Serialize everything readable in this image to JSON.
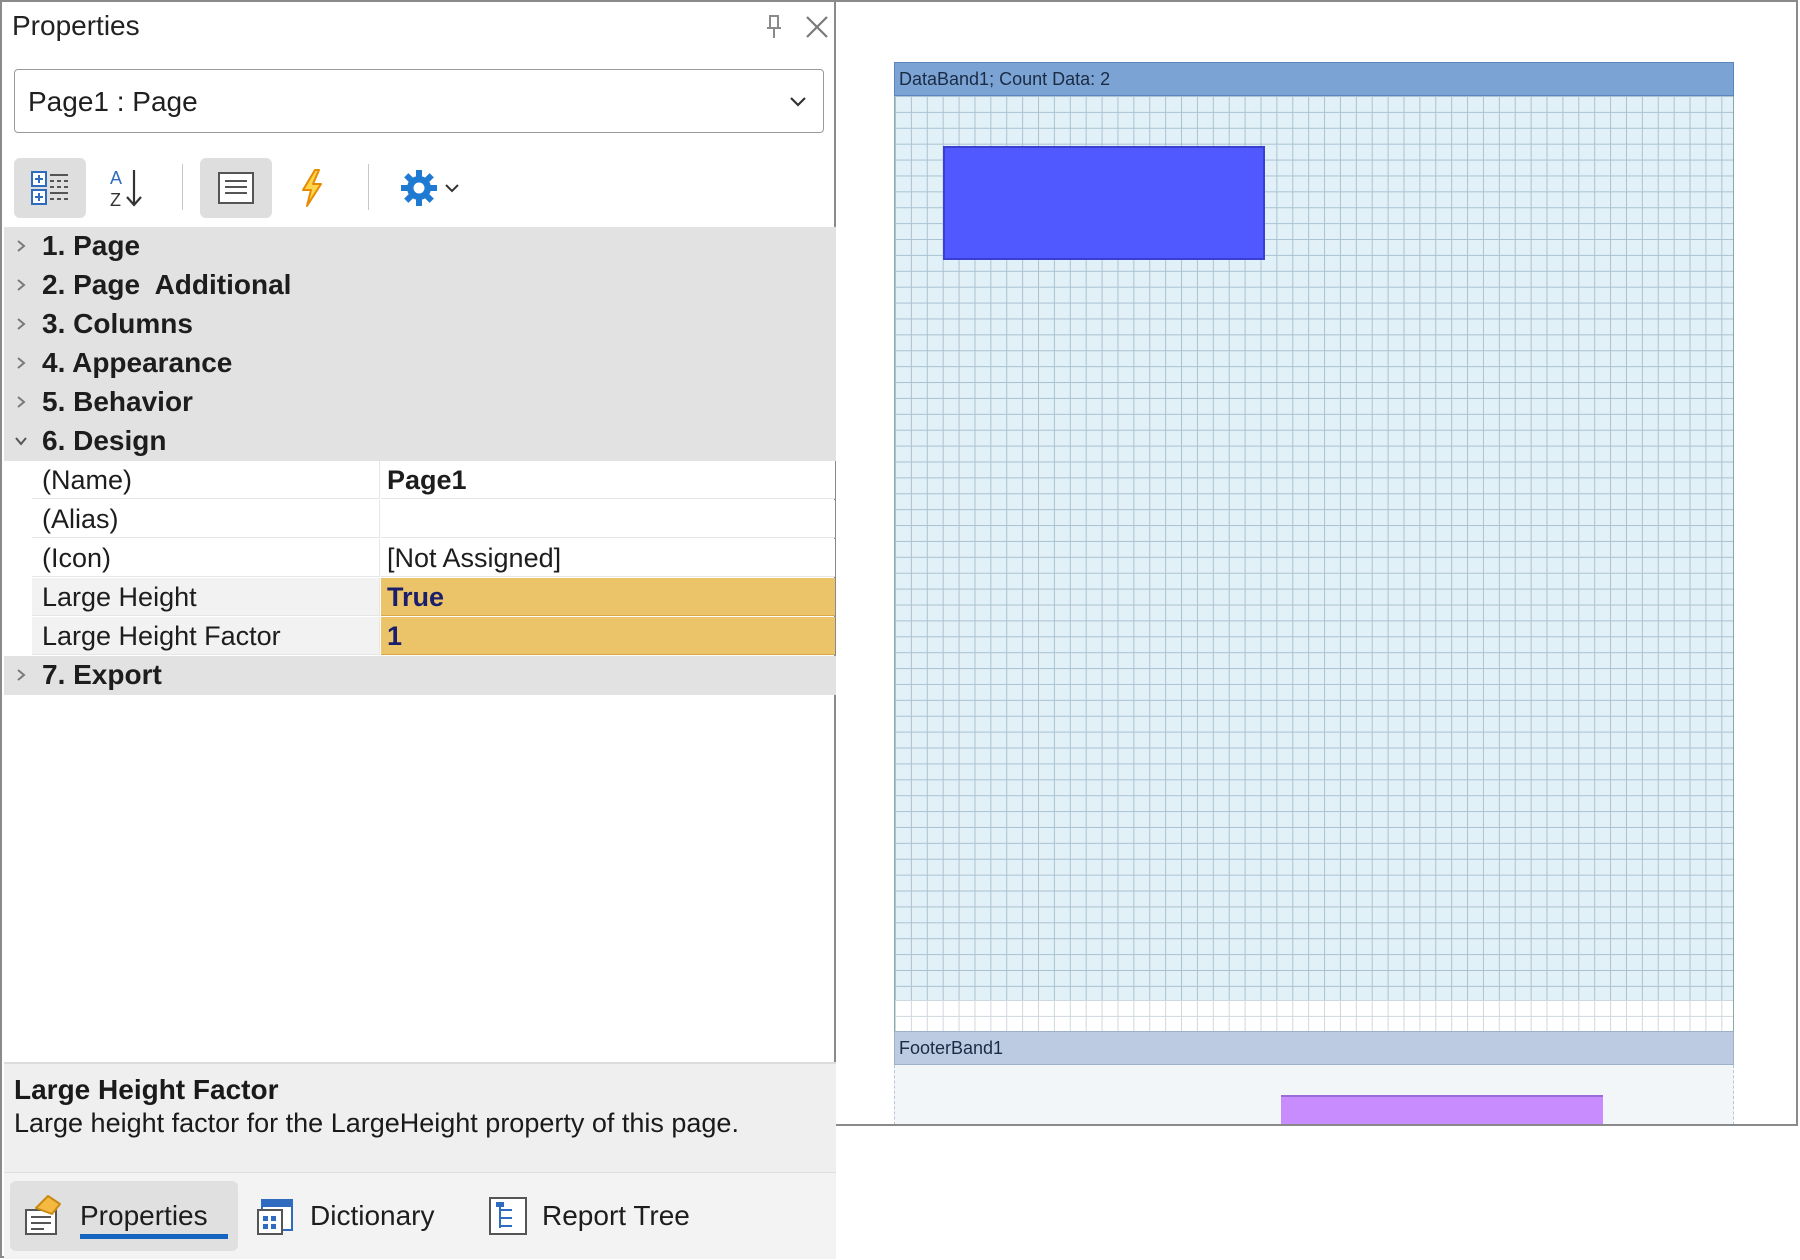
{
  "panel": {
    "title": "Properties",
    "pin_icon": "pin-icon",
    "close_icon": "close-icon",
    "object_selector": {
      "value": "Page1 : Page"
    },
    "toolbar": {
      "buttons": [
        {
          "name": "categorized-view",
          "icon": "categorized-icon",
          "active": true
        },
        {
          "name": "alphabetical-sort",
          "icon": "sort-az-icon",
          "active": false
        },
        {
          "name": "properties-view",
          "icon": "property-list-icon",
          "active": true
        },
        {
          "name": "events-view",
          "icon": "lightning-icon",
          "active": false
        },
        {
          "name": "settings",
          "icon": "gear-icon",
          "active": false
        }
      ]
    },
    "categories": [
      {
        "label": "1. Page",
        "expanded": false
      },
      {
        "label": "2. Page  Additional",
        "expanded": false
      },
      {
        "label": "3. Columns",
        "expanded": false
      },
      {
        "label": "4. Appearance",
        "expanded": false
      },
      {
        "label": "5. Behavior",
        "expanded": false
      },
      {
        "label": "6. Design",
        "expanded": true
      },
      {
        "label": "7. Export",
        "expanded": false
      }
    ],
    "design_properties": [
      {
        "name": "(Name)",
        "value": "Page1"
      },
      {
        "name": "(Alias)",
        "value": ""
      },
      {
        "name": "(Icon)",
        "value": "[Not Assigned]"
      },
      {
        "name": "Large Height",
        "value": "True"
      },
      {
        "name": "Large Height Factor",
        "value": "1"
      }
    ],
    "description": {
      "title": "Large Height Factor",
      "text": "Large height factor for the LargeHeight property of this page."
    },
    "bottom_tabs": [
      {
        "label": "Properties",
        "icon": "properties-icon",
        "active": true
      },
      {
        "label": "Dictionary",
        "icon": "dictionary-icon",
        "active": false
      },
      {
        "label": "Report Tree",
        "icon": "report-tree-icon",
        "active": false
      }
    ]
  },
  "designer": {
    "databand_label": "DataBand1; Count Data: 2",
    "footer_label": "FooterBand1",
    "colors": {
      "databand_header": "#7ba3d4",
      "databand_body": "#e2f0f7",
      "blue_component": "#5058ff",
      "purple_component": "#c98cff",
      "highlight": "#ebc46a",
      "accent": "#1565c0"
    }
  }
}
